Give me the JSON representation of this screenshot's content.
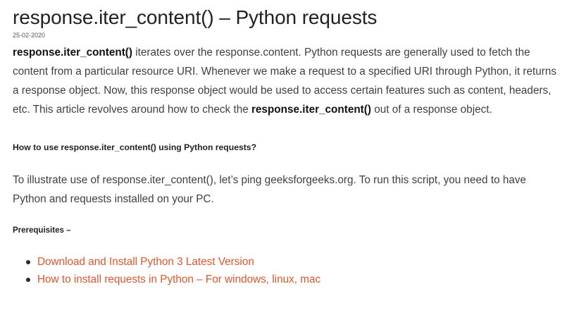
{
  "article": {
    "title": "response.iter_content() – Python requests",
    "date": "25-02-2020",
    "intro": {
      "bold_start": "response.iter_content()",
      "text_a": " iterates over the response.content. Python requests are generally used to fetch the content from a particular resource URI. Whenever we make a request to a specified URI through Python, it returns a response object. Now, this response object would be used to access certain features such as content, headers, etc. This article revolves around how to check the ",
      "bold_mid": "response.iter_content()",
      "text_b": " out of a response object."
    },
    "howto_heading": "How to use response.iter_content() using Python requests?",
    "howto_text": "To illustrate use of response.iter_content(), let’s ping geeksforgeeks.org. To run this script, you need to have Python and requests installed on your PC.",
    "prereq_heading": "Prerequisites –",
    "links": [
      {
        "label": "Download and Install Python 3 Latest Version"
      },
      {
        "label": "How to install requests in Python – For windows, linux, mac"
      }
    ]
  },
  "colors": {
    "link": "#e0552b",
    "text": "#3f3f3f",
    "heading": "#222222"
  }
}
